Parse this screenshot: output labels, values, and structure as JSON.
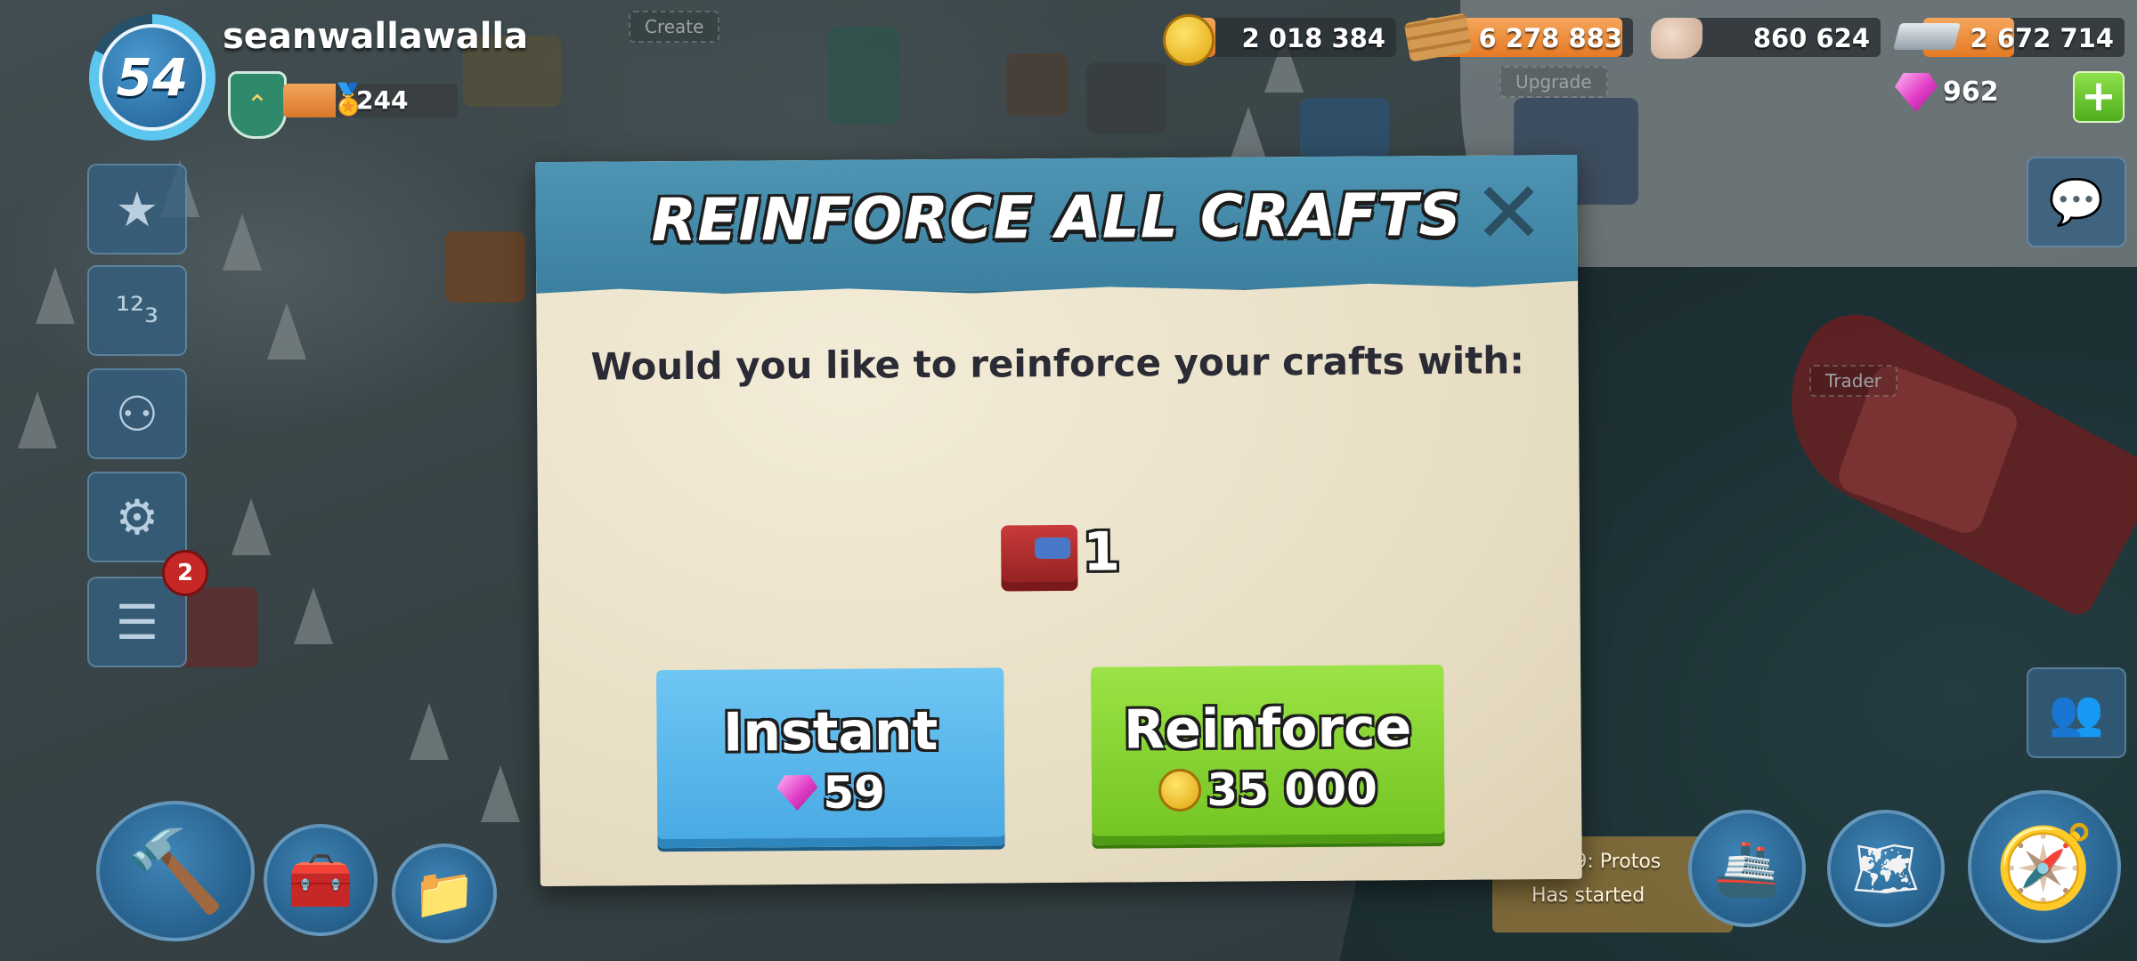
{
  "hud": {
    "level": "54",
    "player_name": "seanwallawalla",
    "victory_points": "244",
    "victory_points_fill": 0.3
  },
  "resources": {
    "gold": "2 018 384",
    "wood": "6 278 883",
    "stone": "860 624",
    "iron": "2 672 714",
    "diamonds": "962",
    "add_label": "+"
  },
  "map_labels": {
    "create": "Create",
    "upgrade": "Upgrade",
    "trader": "Trader"
  },
  "side_buttons": {
    "notification_count": "2"
  },
  "operation_banner": {
    "line1": "on 29: Protos",
    "line2": "Has started"
  },
  "modal": {
    "title": "REINFORCE ALL CRAFTS",
    "close_label": "✕",
    "prompt": "Would you like to reinforce your crafts with:",
    "craft_count": "1",
    "instant": {
      "label": "Instant",
      "cost": "59"
    },
    "reinforce": {
      "label": "Reinforce",
      "cost": "35 000"
    }
  },
  "colors": {
    "header_blue": "#4e94b3",
    "instant_blue": "#6fc6f3",
    "reinforce_green": "#9be346",
    "parchment": "#ece3cc"
  }
}
